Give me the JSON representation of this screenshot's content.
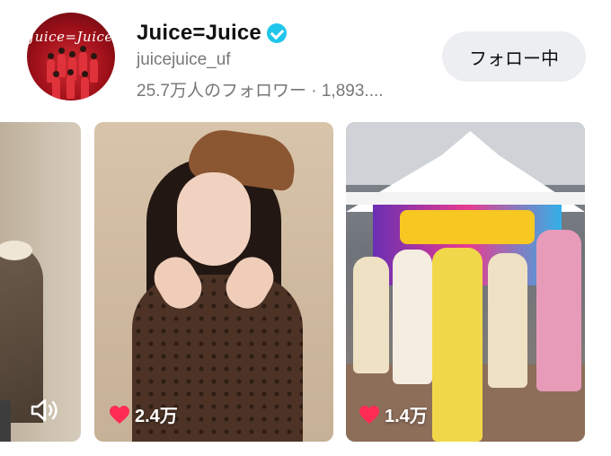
{
  "profile": {
    "avatar_logo_text": "Juice=Juice",
    "account_name": "Juice=Juice",
    "verified": true,
    "username": "juicejuice_uf",
    "stats": "25.7万人のフォロワー · 1,893....",
    "follow_button_label": "フォロー中"
  },
  "videos": [
    {
      "id": "video-1",
      "likes": "",
      "icon": "volume-icon"
    },
    {
      "id": "video-2",
      "likes": "2.4万",
      "icon": "heart-icon"
    },
    {
      "id": "video-3",
      "likes": "1.4万",
      "icon": "heart-icon"
    }
  ],
  "colors": {
    "verified_badge": "#20c5ea",
    "heart": "#fe2c55",
    "follow_button_bg": "#eceef1",
    "secondary_text": "#777777"
  }
}
